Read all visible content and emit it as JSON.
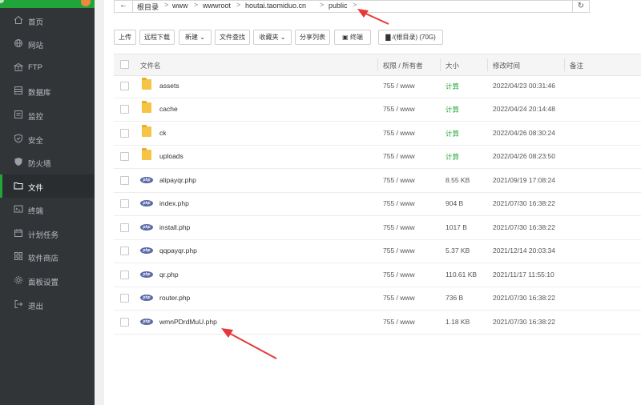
{
  "sidebar": {
    "items": [
      {
        "label": "首页",
        "icon": "home-icon"
      },
      {
        "label": "网站",
        "icon": "globe-icon"
      },
      {
        "label": "FTP",
        "icon": "ftp-icon"
      },
      {
        "label": "数据库",
        "icon": "database-icon"
      },
      {
        "label": "监控",
        "icon": "monitor-icon"
      },
      {
        "label": "安全",
        "icon": "shield-icon"
      },
      {
        "label": "防火墙",
        "icon": "firewall-icon"
      },
      {
        "label": "文件",
        "icon": "folder-icon",
        "active": true
      },
      {
        "label": "终端",
        "icon": "terminal-icon"
      },
      {
        "label": "计划任务",
        "icon": "calendar-icon"
      },
      {
        "label": "软件商店",
        "icon": "grid-icon"
      },
      {
        "label": "面板设置",
        "icon": "gear-icon"
      },
      {
        "label": "退出",
        "icon": "logout-icon"
      }
    ]
  },
  "path": {
    "crumbs": [
      "根目录",
      "www",
      "wwwroot",
      "houtai.taomiduo.cn",
      "public"
    ],
    "separator": ">"
  },
  "toolbar": {
    "upload": "上传",
    "remote_download": "远程下载",
    "new": "新建",
    "file_search": "文件查找",
    "favorites": "收藏夹",
    "share_list": "分享列表",
    "terminal": "终端",
    "disk": "/(根目录) (70G)"
  },
  "table": {
    "headers": {
      "name": "文件名",
      "perm": "权限 / 所有者",
      "size": "大小",
      "mtime": "修改时间",
      "note": "备注"
    },
    "rows": [
      {
        "type": "folder",
        "name": "assets",
        "perm": "755 / www",
        "size": "计算",
        "mtime": "2022/04/23 00:31:46"
      },
      {
        "type": "folder",
        "name": "cache",
        "perm": "755 / www",
        "size": "计算",
        "mtime": "2022/04/24 20:14:48"
      },
      {
        "type": "folder",
        "name": "ck",
        "perm": "755 / www",
        "size": "计算",
        "mtime": "2022/04/26 08:30:24"
      },
      {
        "type": "folder",
        "name": "uploads",
        "perm": "755 / www",
        "size": "计算",
        "mtime": "2022/04/26 08:23:50"
      },
      {
        "type": "php",
        "name": "alipayqr.php",
        "perm": "755 / www",
        "size": "8.55 KB",
        "mtime": "2021/09/19 17:08:24"
      },
      {
        "type": "php",
        "name": "index.php",
        "perm": "755 / www",
        "size": "904 B",
        "mtime": "2021/07/30 16:38:22"
      },
      {
        "type": "php",
        "name": "install.php",
        "perm": "755 / www",
        "size": "1017 B",
        "mtime": "2021/07/30 16:38:22"
      },
      {
        "type": "php",
        "name": "qqpayqr.php",
        "perm": "755 / www",
        "size": "5.37 KB",
        "mtime": "2021/12/14 20:03:34"
      },
      {
        "type": "php",
        "name": "qr.php",
        "perm": "755 / www",
        "size": "110.61 KB",
        "mtime": "2021/11/17 11:55:10"
      },
      {
        "type": "php",
        "name": "router.php",
        "perm": "755 / www",
        "size": "736 B",
        "mtime": "2021/07/30 16:38:22"
      },
      {
        "type": "php",
        "name": "wmnPDrdMuU.php",
        "perm": "755 / www",
        "size": "1.18 KB",
        "mtime": "2021/07/30 16:38:22"
      }
    ],
    "php_badge": "php"
  },
  "colors": {
    "sidebar_bg": "#323538",
    "accent_green": "#20a53a",
    "annotation_arrow": "#e8373a",
    "folder": "#f5c445",
    "php_badge": "#5b68a8"
  }
}
